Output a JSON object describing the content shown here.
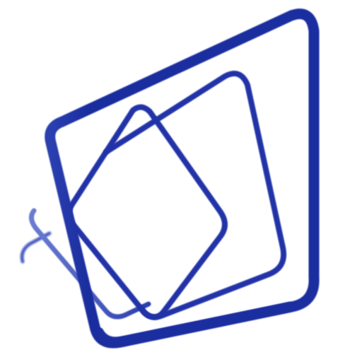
{
  "logo": {
    "icon": "stacked-cards-icon",
    "colors": {
      "background": "#ffffff",
      "stroke_dark": "#1b2ea0",
      "stroke_mid": "#2a3fb0",
      "stroke_light": "#4a5ec4"
    }
  }
}
